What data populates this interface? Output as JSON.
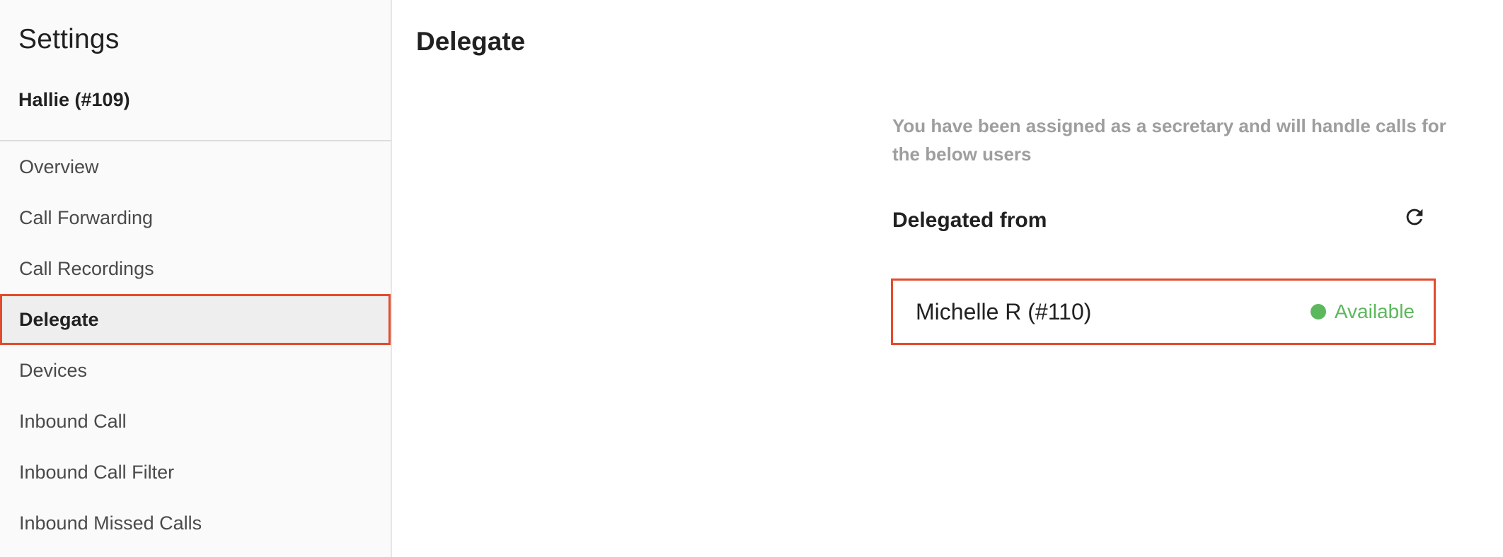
{
  "sidebar": {
    "title": "Settings",
    "user": "Hallie (#109)",
    "items": [
      {
        "label": "Overview"
      },
      {
        "label": "Call Forwarding"
      },
      {
        "label": "Call Recordings"
      },
      {
        "label": "Delegate",
        "active": true
      },
      {
        "label": "Devices"
      },
      {
        "label": "Inbound Call"
      },
      {
        "label": "Inbound Call Filter"
      },
      {
        "label": "Inbound Missed Calls"
      }
    ]
  },
  "main": {
    "title": "Delegate",
    "description": "You have been assigned as a secretary and will handle calls for the below users",
    "section_title": "Delegated from",
    "refresh_icon": "refresh-icon",
    "delegations": [
      {
        "name": "Michelle R (#110)",
        "status": "Available",
        "status_color": "#5cb85c"
      }
    ]
  },
  "colors": {
    "highlight": "#e24b2c",
    "available": "#5cb85c",
    "muted_text": "#9e9e9e"
  }
}
